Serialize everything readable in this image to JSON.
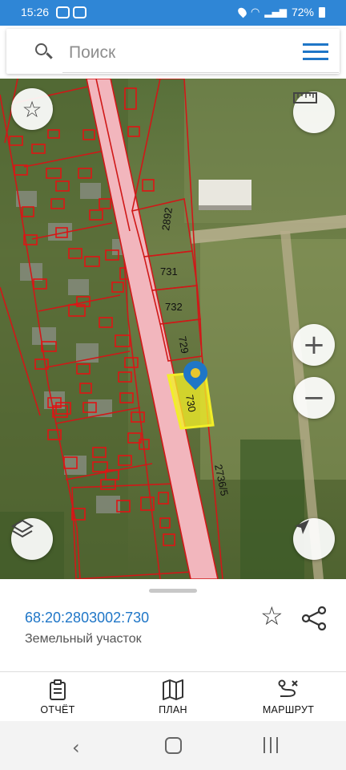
{
  "status_bar": {
    "time": "15:26",
    "battery": "72%"
  },
  "search": {
    "placeholder": "Поиск",
    "search_icon": "search-icon",
    "menu_icon": "hamburger-menu-icon"
  },
  "map": {
    "parcel_labels": [
      "2892",
      "731",
      "732",
      "729",
      "730",
      "2736/5"
    ],
    "selected_parcel": "730",
    "controls": {
      "favorite": "star-icon",
      "ruler": "ruler-icon",
      "zoom_in": "+",
      "zoom_out": "−",
      "layers": "layers-icon",
      "locate": "navigation-arrow-icon"
    }
  },
  "sheet": {
    "cadastral_number": "68:20:2803002:730",
    "object_type": "Земельный участок"
  },
  "actions": [
    {
      "label": "ОТЧЁТ",
      "icon": "report-clipboard-icon"
    },
    {
      "label": "ПЛАН",
      "icon": "map-plan-icon"
    },
    {
      "label": "МАРШРУТ",
      "icon": "route-icon"
    }
  ],
  "colors": {
    "accent": "#1f76c7",
    "parcel_outline": "#d01818",
    "road_fill": "#f2b6bd",
    "selected_fill": "#f2ee28"
  }
}
